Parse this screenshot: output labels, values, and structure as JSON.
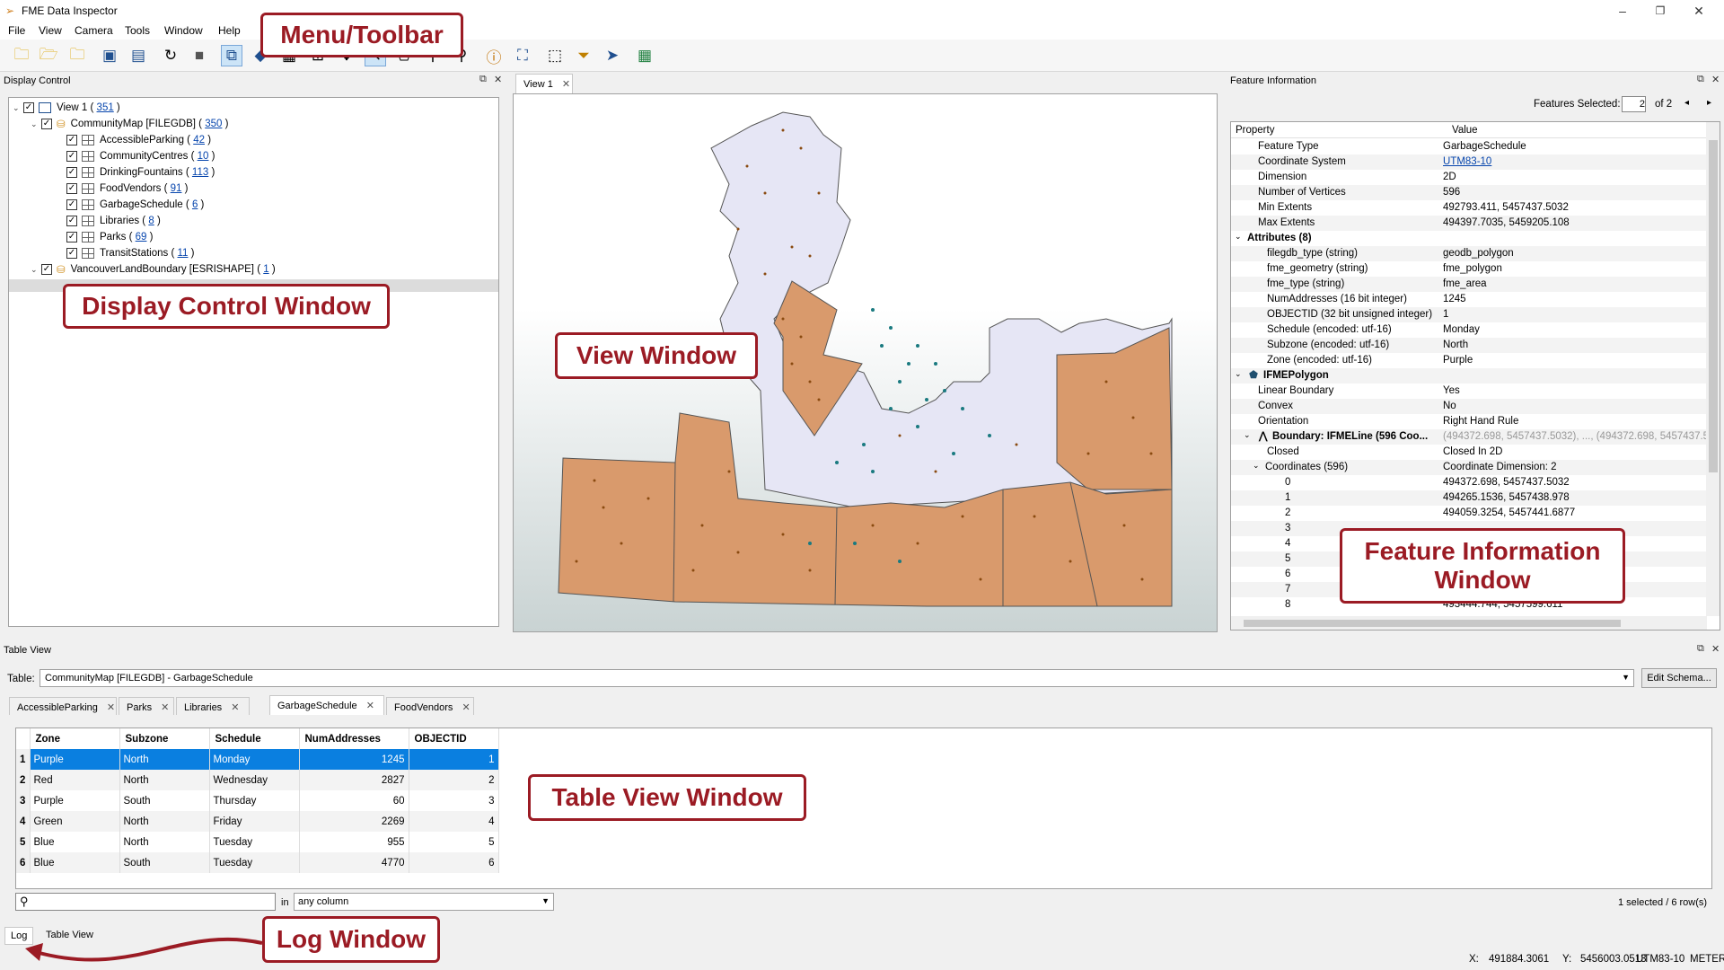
{
  "window": {
    "title": "FME Data Inspector",
    "min": "–",
    "max": "❐",
    "close": "✕"
  },
  "menu": [
    "File",
    "View",
    "Camera",
    "Tools",
    "Window",
    "Help"
  ],
  "display_control": {
    "title": "Display Control",
    "tree": [
      {
        "label": "View 1",
        "count": "351",
        "level": 0
      },
      {
        "label": "CommunityMap [FILEGDB]",
        "count": "350",
        "level": 1
      },
      {
        "label": "AccessibleParking",
        "count": "42",
        "level": 2
      },
      {
        "label": "CommunityCentres",
        "count": "10",
        "level": 2
      },
      {
        "label": "DrinkingFountains",
        "count": "113",
        "level": 2
      },
      {
        "label": "FoodVendors",
        "count": "91",
        "level": 2
      },
      {
        "label": "GarbageSchedule",
        "count": "6",
        "level": 2
      },
      {
        "label": "Libraries",
        "count": "8",
        "level": 2
      },
      {
        "label": "Parks",
        "count": "69",
        "level": 2
      },
      {
        "label": "TransitStations",
        "count": "11",
        "level": 2
      },
      {
        "label": "VancouverLandBoundary [ESRISHAPE]",
        "count": "1",
        "level": 1
      }
    ]
  },
  "view": {
    "tab": "View 1"
  },
  "feature_info": {
    "title": "Feature Information",
    "selected_label": "Features Selected:",
    "selected_value": "2",
    "of_label": "of 2",
    "col_property": "Property",
    "col_value": "Value",
    "rows": [
      {
        "p": "Feature Type",
        "v": "GarbageSchedule",
        "i": 1
      },
      {
        "p": "Coordinate System",
        "v": "UTM83-10",
        "i": 1,
        "link": true
      },
      {
        "p": "Dimension",
        "v": "2D",
        "i": 1
      },
      {
        "p": "Number of Vertices",
        "v": "596",
        "i": 1
      },
      {
        "p": "Min Extents",
        "v": "492793.411, 5457437.5032",
        "i": 1
      },
      {
        "p": "Max Extents",
        "v": "494397.7035, 5459205.108",
        "i": 1
      },
      {
        "p": "Attributes (8)",
        "v": "",
        "i": 0,
        "bold": true,
        "exp": true
      },
      {
        "p": "filegdb_type (string)",
        "v": "geodb_polygon",
        "i": 2
      },
      {
        "p": "fme_geometry (string)",
        "v": "fme_polygon",
        "i": 2
      },
      {
        "p": "fme_type (string)",
        "v": "fme_area",
        "i": 2
      },
      {
        "p": "NumAddresses (16 bit integer)",
        "v": "1245",
        "i": 2
      },
      {
        "p": "OBJECTID (32 bit unsigned integer)",
        "v": "1",
        "i": 2
      },
      {
        "p": "Schedule (encoded: utf-16)",
        "v": "Monday",
        "i": 2
      },
      {
        "p": "Subzone (encoded: utf-16)",
        "v": "North",
        "i": 2
      },
      {
        "p": "Zone (encoded: utf-16)",
        "v": "Purple",
        "i": 2
      },
      {
        "p": "IFMEPolygon",
        "v": "",
        "i": 0,
        "bold": true,
        "exp": true,
        "poly": true
      },
      {
        "p": "Linear Boundary",
        "v": "Yes",
        "i": 1
      },
      {
        "p": "Convex",
        "v": "No",
        "i": 1
      },
      {
        "p": "Orientation",
        "v": "Right Hand Rule",
        "i": 1
      },
      {
        "p": "Boundary: IFMELine (596 Coo...",
        "v": "(494372.698, 5457437.5032), ..., (494372.698, 5457437.5",
        "i": 1,
        "bold": true,
        "exp": true,
        "line": true,
        "grey": true
      },
      {
        "p": "Closed",
        "v": "Closed In 2D",
        "i": 2
      },
      {
        "p": "Coordinates (596)",
        "v": "Coordinate Dimension: 2",
        "i": 2,
        "exp": true
      },
      {
        "p": "0",
        "v": "494372.698, 5457437.5032",
        "i": 4
      },
      {
        "p": "1",
        "v": "494265.1536, 5457438.978",
        "i": 4
      },
      {
        "p": "2",
        "v": "494059.3254, 5457441.6877",
        "i": 4
      },
      {
        "p": "3",
        "v": "",
        "i": 4
      },
      {
        "p": "4",
        "v": "",
        "i": 4
      },
      {
        "p": "5",
        "v": "",
        "i": 4
      },
      {
        "p": "6",
        "v": "",
        "i": 4
      },
      {
        "p": "7",
        "v": "",
        "i": 4
      },
      {
        "p": "8",
        "v": "493444.744, 5457599.611",
        "i": 4
      }
    ]
  },
  "table_view": {
    "title": "Table View",
    "table_label": "Table:",
    "table_value": "CommunityMap [FILEGDB] - GarbageSchedule",
    "edit_schema": "Edit Schema...",
    "tabs": [
      "AccessibleParking",
      "Parks",
      "Libraries",
      "GarbageSchedule",
      "FoodVendors"
    ],
    "active_tab": 3,
    "columns": [
      "Zone",
      "Subzone",
      "Schedule",
      "NumAddresses",
      "OBJECTID"
    ],
    "rows": [
      [
        "Purple",
        "North",
        "Monday",
        "1245",
        "1"
      ],
      [
        "Red",
        "North",
        "Wednesday",
        "2827",
        "2"
      ],
      [
        "Purple",
        "South",
        "Thursday",
        "60",
        "3"
      ],
      [
        "Green",
        "North",
        "Friday",
        "2269",
        "4"
      ],
      [
        "Blue",
        "North",
        "Tuesday",
        "955",
        "5"
      ],
      [
        "Blue",
        "South",
        "Tuesday",
        "4770",
        "6"
      ]
    ],
    "search_in": "in",
    "search_col": "any column",
    "status": "1 selected / 6 row(s)"
  },
  "bottom_tabs": [
    "Log",
    "Table View"
  ],
  "statusbar": {
    "x_label": "X:",
    "x": "491884.3061",
    "y_label": "Y:",
    "y": "5456003.0513",
    "cs": "UTM83-10",
    "units": "METER"
  },
  "annotations": {
    "toolbar": "Menu/Toolbar",
    "display": "Display Control Window",
    "view": "View Window",
    "feature": "Feature Information Window",
    "table": "Table View Window",
    "log": "Log Window"
  },
  "colors": {
    "annotation": "#9b1b24",
    "selection": "#0a7fe0",
    "zone_fill": "#d99a6c",
    "land_fill": "#e6e6f5"
  }
}
